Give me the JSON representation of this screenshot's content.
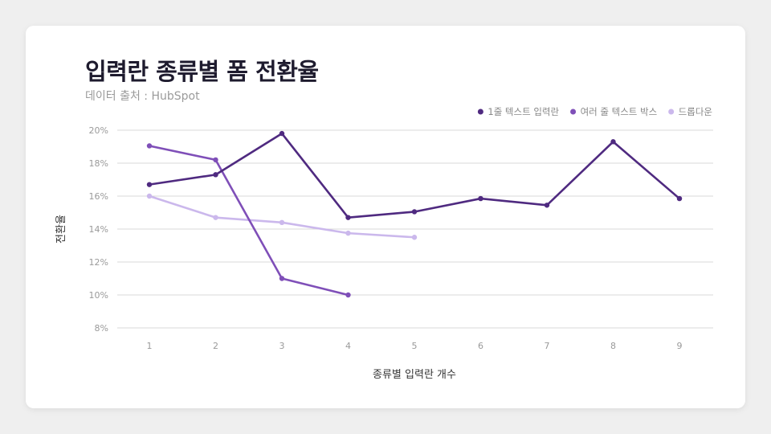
{
  "chart_data": {
    "type": "line",
    "title": "입력란 종류별 폼 전환율",
    "subtitle": "데이터 출처 : HubSpot",
    "xlabel": "종류별 입력란 개수",
    "ylabel": "전환율",
    "x": [
      1,
      2,
      3,
      4,
      5,
      6,
      7,
      8,
      9
    ],
    "x_tick_labels": [
      "1",
      "2",
      "3",
      "4",
      "5",
      "6",
      "7",
      "8",
      "9"
    ],
    "ylim": [
      8,
      20
    ],
    "y_ticks": [
      8,
      10,
      12,
      14,
      16,
      18,
      20
    ],
    "y_tick_labels": [
      "8%",
      "10%",
      "12%",
      "14%",
      "16%",
      "18%",
      "20%"
    ],
    "grid": true,
    "legend_position": "top-right",
    "series": [
      {
        "name": "1줄 텍스트 입력란",
        "color": "#4f2a80",
        "values": [
          16.7,
          17.3,
          19.8,
          14.7,
          15.05,
          15.85,
          15.45,
          19.3,
          15.85
        ]
      },
      {
        "name": "여러 줄 텍스트 박스",
        "color": "#7f4fb8",
        "values": [
          19.05,
          18.2,
          11.0,
          10.0,
          null,
          null,
          null,
          null,
          null
        ]
      },
      {
        "name": "드롭다운",
        "color": "#cbb8ec",
        "values": [
          16.0,
          14.7,
          14.4,
          13.75,
          13.5,
          null,
          null,
          null,
          null
        ]
      }
    ]
  }
}
